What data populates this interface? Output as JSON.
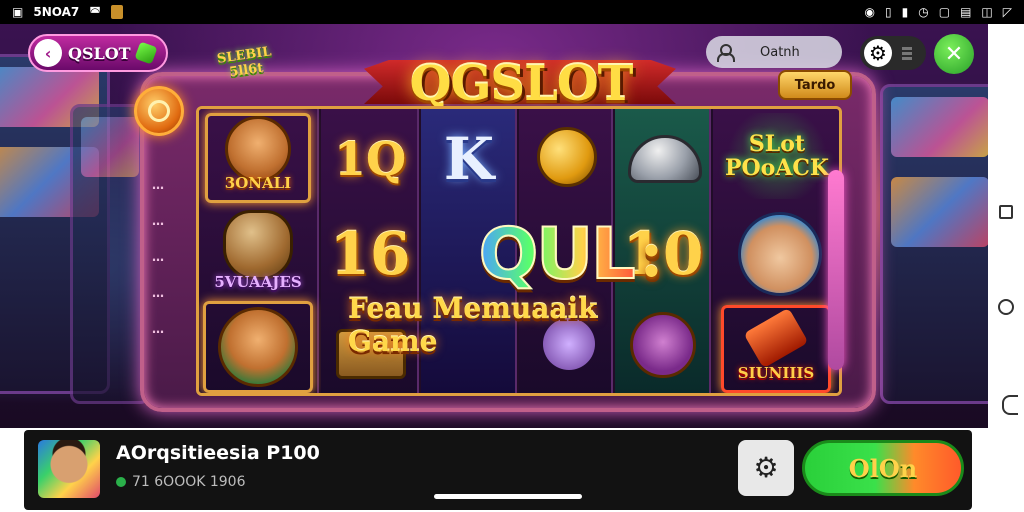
{
  "status_bar": {
    "left_text": "5NOA7",
    "icons_left": [
      "sim-icon",
      "cast-icon",
      "app-notification-icon"
    ],
    "icons_right": [
      "location-icon",
      "vibrate-icon",
      "sim-card-icon",
      "alarm-icon",
      "screenshot-icon",
      "battery-icon",
      "wifi-icon"
    ]
  },
  "game": {
    "brand_pill": {
      "label": "QSLOT"
    },
    "sub_logo": "SLEBIL\n5ll6t",
    "logo": "QGSLOT",
    "search": {
      "label": "Oatnh"
    },
    "tag": {
      "label": "Tardo"
    },
    "reels": {
      "col1": {
        "top_label": "3ONALI",
        "mid_label": "5VUAAJES"
      },
      "col2": {
        "top": "1Q",
        "mid": "16"
      },
      "col3": {
        "top": "K",
        "mid": "QUL"
      },
      "col4": {
        "mid": ":"
      },
      "col5": {
        "mid": "10"
      },
      "col6": {
        "top": "SLot\nPOoACK",
        "bottom_label": "SIUNIIIS"
      }
    },
    "side_rail": [
      "…",
      "…",
      "…",
      "…",
      "…"
    ],
    "promo": "Feau Memuaaik Game"
  },
  "bottom_card": {
    "title": "AOrqsitieesia P100",
    "meta": "71 6OOOK 1906",
    "play_label": "OlOn"
  },
  "colors": {
    "accent_gold": "#ffd24a",
    "play_green": "#2ad03a",
    "card_bg": "#121212"
  }
}
